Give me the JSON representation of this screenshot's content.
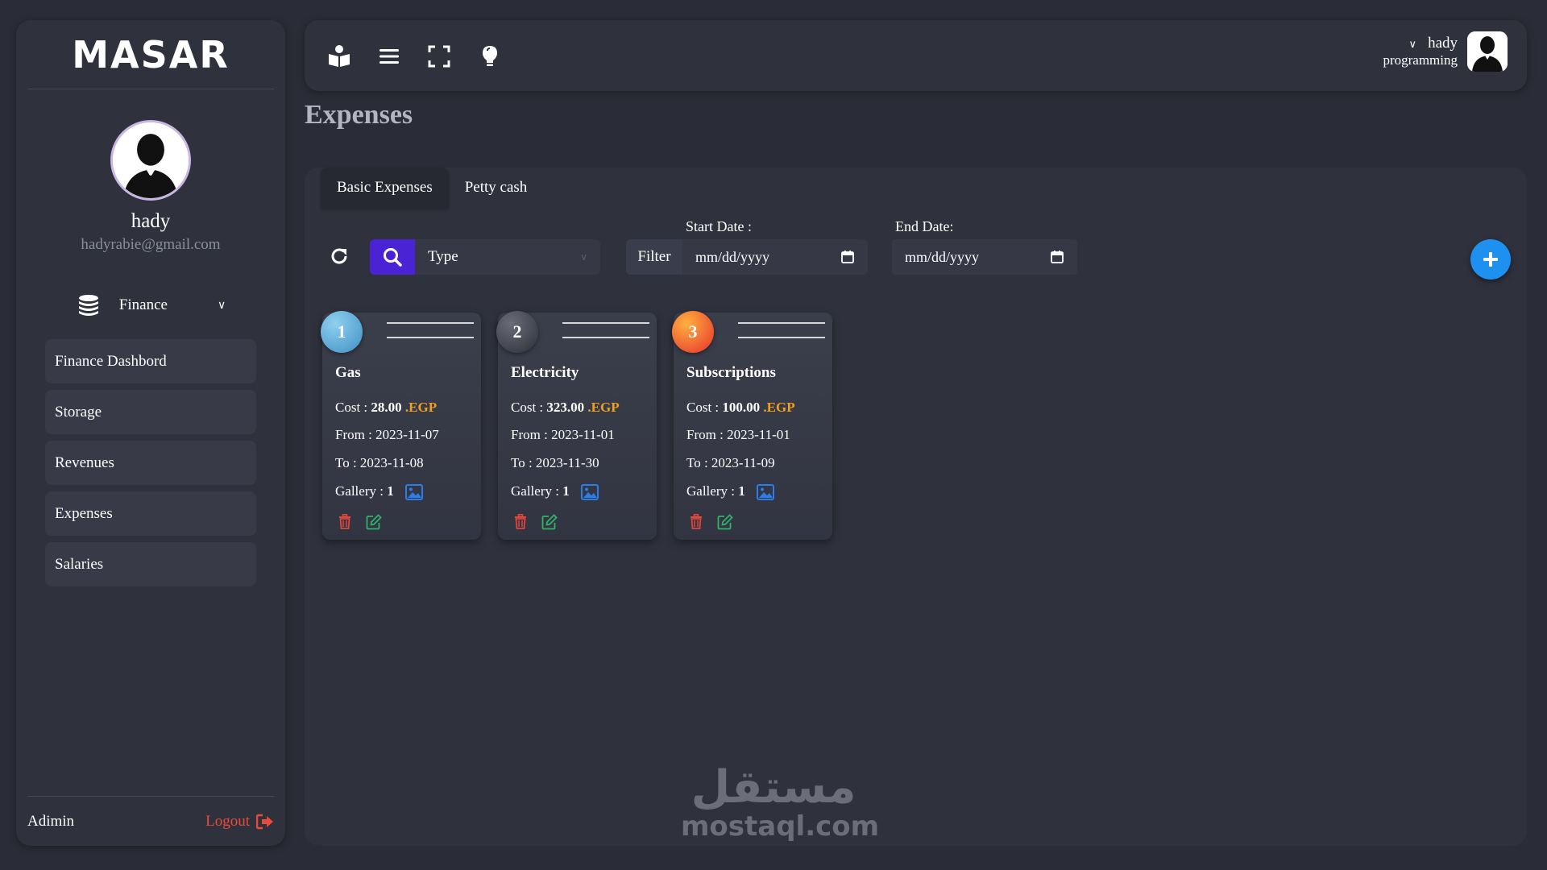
{
  "brand": {
    "logo": "MASAR"
  },
  "profile": {
    "name": "hady",
    "email": "hadyrabie@gmail.com"
  },
  "sidebar": {
    "section_label": "Finance",
    "items": [
      {
        "label": "Finance Dashbord"
      },
      {
        "label": "Storage"
      },
      {
        "label": "Revenues"
      },
      {
        "label": "Expenses"
      },
      {
        "label": "Salaries"
      }
    ],
    "footer_user": "Adimin",
    "logout_label": "Logout"
  },
  "topbar": {
    "icons": [
      "book-reader-icon",
      "menu-icon",
      "fullscreen-icon",
      "lightbulb-icon"
    ],
    "user_name": "hady",
    "user_role": "programming"
  },
  "page": {
    "title": "Expenses"
  },
  "tabs": [
    {
      "label": "Basic Expenses",
      "active": true
    },
    {
      "label": "Petty cash",
      "active": false
    }
  ],
  "filters": {
    "type_placeholder": "Type",
    "filter_label": "Filter",
    "start_date_label": "Start Date :",
    "start_date_placeholder": "mm/dd/yyyy",
    "end_date_label": "End Date:",
    "end_date_placeholder": "mm/dd/yyyy"
  },
  "cards": [
    {
      "num": "1",
      "title": "Gas",
      "cost_label": "Cost :",
      "cost": "28.00",
      "currency": ".EGP",
      "from_label": "From :",
      "from": "2023-11-07",
      "to_label": "To :",
      "to": "2023-11-08",
      "gallery_label": "Gallery :",
      "gallery": "1"
    },
    {
      "num": "2",
      "title": "Electricity",
      "cost_label": "Cost :",
      "cost": "323.00",
      "currency": ".EGP",
      "from_label": "From :",
      "from": "2023-11-01",
      "to_label": "To :",
      "to": "2023-11-30",
      "gallery_label": "Gallery :",
      "gallery": "1"
    },
    {
      "num": "3",
      "title": "Subscriptions",
      "cost_label": "Cost :",
      "cost": "100.00",
      "currency": ".EGP",
      "from_label": "From :",
      "from": "2023-11-01",
      "to_label": "To :",
      "to": "2023-11-09",
      "gallery_label": "Gallery :",
      "gallery": "1"
    }
  ],
  "watermark": {
    "arabic": "مستقل",
    "latin": "mostaql.com"
  },
  "colors": {
    "background": "#2a2d37",
    "panel": "#2f323d",
    "search_button": "#4a23d4",
    "add_button": "#1e90f0",
    "currency": "#f0a020",
    "delete": "#e0453a",
    "edit": "#2fb36a",
    "logout": "#e84a3c",
    "badge_1": "#5aa9d6",
    "badge_2": "#4a4d58",
    "badge_3": "#f04a2a"
  }
}
